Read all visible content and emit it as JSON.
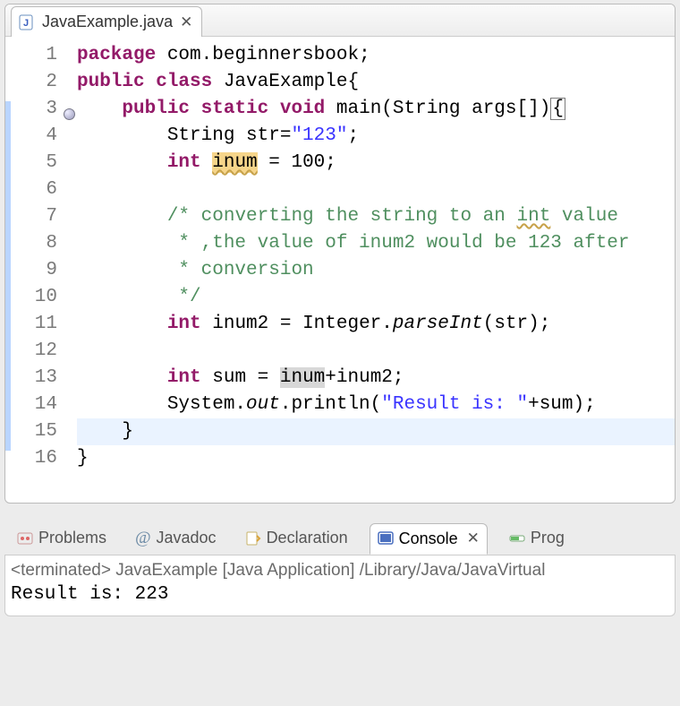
{
  "editor": {
    "tab": {
      "filename": "JavaExample.java"
    },
    "lines": [
      {
        "n": "1",
        "tokens": [
          {
            "t": "package ",
            "c": "kw-purple"
          },
          {
            "t": "com.beginnersbook;",
            "c": "pkg"
          }
        ]
      },
      {
        "n": "2",
        "tokens": [
          {
            "t": "public class ",
            "c": "kw-purple"
          },
          {
            "t": "JavaExample{",
            "c": "pkg"
          }
        ]
      },
      {
        "n": "3",
        "fold": true,
        "hl": true,
        "tokens": [
          {
            "t": "    "
          },
          {
            "t": "public static ",
            "c": "kw-purple"
          },
          {
            "t": "void",
            "c": "kw-void"
          },
          {
            "t": " main(String args[])"
          },
          {
            "t": "{",
            "c": "brace-box"
          }
        ]
      },
      {
        "n": "4",
        "hl": true,
        "tokens": [
          {
            "t": "        String str="
          },
          {
            "t": "\"123\"",
            "c": "str"
          },
          {
            "t": ";"
          }
        ]
      },
      {
        "n": "5",
        "hl": true,
        "tokens": [
          {
            "t": "        "
          },
          {
            "t": "int ",
            "c": "kw-purple"
          },
          {
            "t": "inum",
            "c": "mark-yellow wavy"
          },
          {
            "t": " = 100;"
          }
        ]
      },
      {
        "n": "6",
        "hl": true,
        "tokens": []
      },
      {
        "n": "7",
        "hl": true,
        "tokens": [
          {
            "t": "        "
          },
          {
            "t": "/* converting the string to an ",
            "c": "cmt"
          },
          {
            "t": "int",
            "c": "cmt wavy"
          },
          {
            "t": " value",
            "c": "cmt"
          }
        ]
      },
      {
        "n": "8",
        "hl": true,
        "tokens": [
          {
            "t": "         "
          },
          {
            "t": "* ,the value of inum2 would be 123 after",
            "c": "cmt"
          }
        ]
      },
      {
        "n": "9",
        "hl": true,
        "tokens": [
          {
            "t": "         "
          },
          {
            "t": "* conversion",
            "c": "cmt"
          }
        ]
      },
      {
        "n": "10",
        "hl": true,
        "tokens": [
          {
            "t": "         "
          },
          {
            "t": "*/",
            "c": "cmt"
          }
        ]
      },
      {
        "n": "11",
        "hl": true,
        "tokens": [
          {
            "t": "        "
          },
          {
            "t": "int ",
            "c": "kw-purple"
          },
          {
            "t": "inum2 = Integer."
          },
          {
            "t": "parseInt",
            "c": "italic"
          },
          {
            "t": "(str);"
          }
        ]
      },
      {
        "n": "12",
        "hl": true,
        "tokens": []
      },
      {
        "n": "13",
        "hl": true,
        "tokens": [
          {
            "t": "        "
          },
          {
            "t": "int ",
            "c": "kw-purple"
          },
          {
            "t": "sum = "
          },
          {
            "t": "inum",
            "c": "mark-grey"
          },
          {
            "t": "+inum2;"
          }
        ]
      },
      {
        "n": "14",
        "hl": true,
        "tokens": [
          {
            "t": "        System."
          },
          {
            "t": "out",
            "c": "italic"
          },
          {
            "t": ".println("
          },
          {
            "t": "\"Result is: \"",
            "c": "str"
          },
          {
            "t": "+sum);"
          }
        ]
      },
      {
        "n": "15",
        "hl": true,
        "current": true,
        "tokens": [
          {
            "t": "    }"
          }
        ]
      },
      {
        "n": "16",
        "tokens": [
          {
            "t": "}"
          }
        ]
      }
    ]
  },
  "views": {
    "problems": "Problems",
    "javadoc": "Javadoc",
    "declaration": "Declaration",
    "console": "Console",
    "progress": "Prog"
  },
  "console": {
    "header": "<terminated> JavaExample [Java Application] /Library/Java/JavaVirtual",
    "output": "Result is: 223"
  }
}
